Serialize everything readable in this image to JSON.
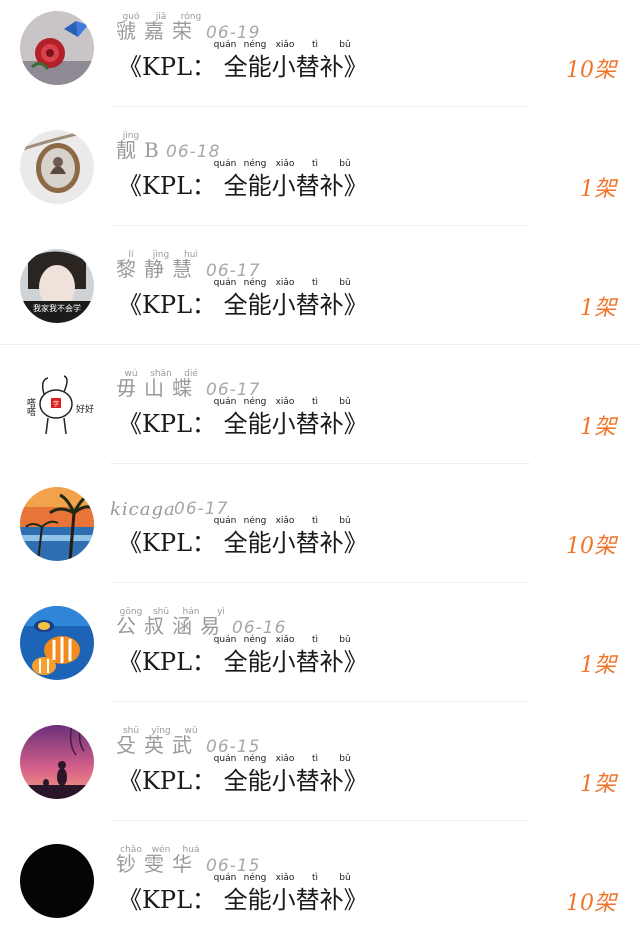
{
  "gift_name": "《KPL： 全能小替补》",
  "gift_pinyin": [
    "quán",
    "néng",
    "xiǎo",
    "tì",
    "bǔ"
  ],
  "rows": [
    {
      "name": "虢嘉荣",
      "pinyin": [
        "guó",
        "jiā",
        "róng"
      ],
      "date": "06-19",
      "count": "10架",
      "avatar": "rose-butterfly-avatar"
    },
    {
      "name": "靓B",
      "pinyin": [
        "jìng",
        "",
        ""
      ],
      "date": "06-18",
      "count": "1架",
      "avatar": "pendant-avatar"
    },
    {
      "name": "黎静慧",
      "pinyin": [
        "lí",
        "jìng",
        "huì"
      ],
      "date": "06-17",
      "count": "1架",
      "avatar": "girl-photo-avatar"
    },
    {
      "name": "毋山蝶",
      "pinyin": [
        "wú",
        "shān",
        "dié"
      ],
      "date": "06-17",
      "count": "1架",
      "avatar": "cartoon-avatar"
    },
    {
      "name": "kicaga",
      "pinyin": [],
      "date": "06-17",
      "count": "10架",
      "avatar": "palm-sunset-avatar"
    },
    {
      "name": "公叔涵易",
      "pinyin": [
        "gōng",
        "shū",
        "hán",
        "yì"
      ],
      "date": "06-16",
      "count": "1架",
      "avatar": "fish-avatar"
    },
    {
      "name": "殳英武",
      "pinyin": [
        "shū",
        "yīng",
        "wǔ"
      ],
      "date": "06-15",
      "count": "1架",
      "avatar": "dusk-avatar"
    },
    {
      "name": "钞雯华",
      "pinyin": [
        "chāo",
        "wén",
        "huá"
      ],
      "date": "06-15",
      "count": "10架",
      "avatar": "black-avatar"
    }
  ],
  "avatar_text": {
    "girl_caption": "我家我不会学",
    "cartoon_left": "嗒嗒",
    "cartoon_right": "好好学",
    "cartoon_badge": "学"
  },
  "colors": {
    "count": "#f0752a",
    "name": "#9a9a9a",
    "divider": "#efefef"
  }
}
